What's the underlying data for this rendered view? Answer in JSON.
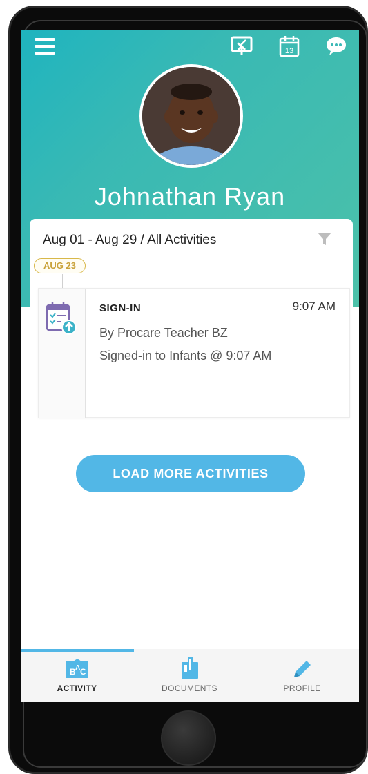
{
  "header": {
    "menu_icon": "hamburger-menu-icon",
    "actions": [
      "check-in-icon",
      "calendar-icon",
      "chat-icon"
    ],
    "calendar_day": "13"
  },
  "profile": {
    "child_name": "Johnathan Ryan"
  },
  "feed": {
    "filter_label": "Aug 01 - Aug 29 / All Activities",
    "filter_icon": "filter-icon",
    "date_pill": "AUG 23",
    "activities": [
      {
        "type": "SIGN-IN",
        "time": "9:07 AM",
        "by": "By Procare Teacher BZ",
        "detail": "Signed-in to Infants @ 9:07 AM",
        "icon": "checklist-upload-icon"
      }
    ],
    "load_more_label": "LOAD MORE ACTIVITIES"
  },
  "tabs": [
    {
      "label": "ACTIVITY",
      "icon": "activity-abc-icon",
      "active": true
    },
    {
      "label": "DOCUMENTS",
      "icon": "documents-icon",
      "active": false
    },
    {
      "label": "PROFILE",
      "icon": "pencil-icon",
      "active": false
    }
  ],
  "colors": {
    "accent": "#52b7e6",
    "hero_start": "#1fb4bf",
    "hero_end": "#4cc1a9",
    "pill": "#d8b84a"
  }
}
